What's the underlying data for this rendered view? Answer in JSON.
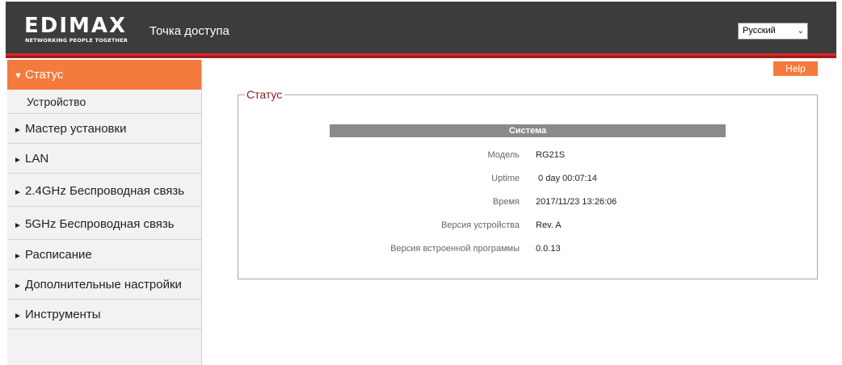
{
  "header": {
    "logo_text": "EDIMAX",
    "logo_tagline": "NETWORKING PEOPLE TOGETHER",
    "title": "Точка доступа",
    "language_selected": "Русский"
  },
  "sidebar": {
    "items": [
      {
        "label": "Статус",
        "arrow": "▼"
      },
      {
        "label": "Устройство"
      },
      {
        "label": "Мастер установки",
        "arrow": "►"
      },
      {
        "label": "LAN",
        "arrow": "►"
      },
      {
        "label": "2.4GHz Беспроводная связь",
        "arrow": "►"
      },
      {
        "label": "5GHz Беспроводная связь",
        "arrow": "►"
      },
      {
        "label": "Расписание",
        "arrow": "►"
      },
      {
        "label": "Дополнительные настройки",
        "arrow": "►"
      },
      {
        "label": "Инструменты",
        "arrow": "►"
      }
    ]
  },
  "main": {
    "help_label": "Help",
    "section_title": "Статус",
    "table_header": "Система",
    "rows": [
      {
        "label": "Модель",
        "value": "RG21S"
      },
      {
        "label": "Uptime",
        "value": " 0 day 00:07:14"
      },
      {
        "label": "Время",
        "value": "2017/11/23 13:26:06"
      },
      {
        "label": "Версия устройства",
        "value": "Rev. A"
      },
      {
        "label": "Версия встроенной программы",
        "value": "0.0.13"
      }
    ]
  },
  "colors": {
    "accent": "#f47a3d",
    "header_bg": "#3c3c3c",
    "brand_red": "#d8272b"
  }
}
